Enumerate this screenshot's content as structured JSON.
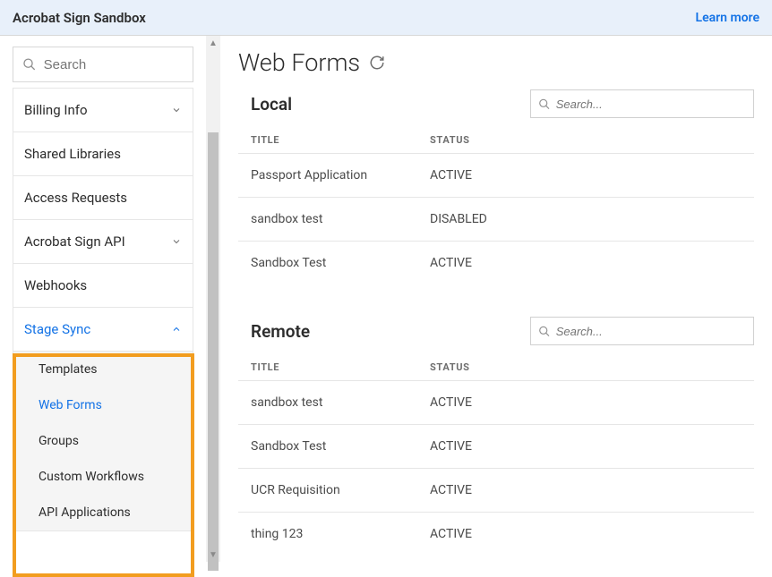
{
  "top": {
    "title": "Acrobat Sign Sandbox",
    "learn_more": "Learn more"
  },
  "sidebar": {
    "search_placeholder": "Search",
    "items": [
      {
        "label": "Billing Info",
        "chevron": "down"
      },
      {
        "label": "Shared Libraries"
      },
      {
        "label": "Access Requests"
      },
      {
        "label": "Acrobat Sign API",
        "chevron": "down"
      },
      {
        "label": "Webhooks"
      },
      {
        "label": "Stage Sync",
        "chevron": "up",
        "active": true
      }
    ],
    "stage_sync_children": [
      {
        "label": "Templates"
      },
      {
        "label": "Web Forms",
        "active": true
      },
      {
        "label": "Groups"
      },
      {
        "label": "Custom Workflows"
      },
      {
        "label": "API Applications"
      }
    ]
  },
  "main": {
    "title": "Web Forms",
    "columns": {
      "title": "TITLE",
      "status": "STATUS"
    },
    "search_placeholder": "Search...",
    "local": {
      "heading": "Local",
      "rows": [
        {
          "title": "Passport Application",
          "status": "ACTIVE"
        },
        {
          "title": "sandbox test",
          "status": "DISABLED"
        },
        {
          "title": "Sandbox Test",
          "status": "ACTIVE"
        }
      ]
    },
    "remote": {
      "heading": "Remote",
      "rows": [
        {
          "title": "sandbox test",
          "status": "ACTIVE"
        },
        {
          "title": "Sandbox Test",
          "status": "ACTIVE"
        },
        {
          "title": "UCR Requisition",
          "status": "ACTIVE"
        },
        {
          "title": "thing 123",
          "status": "ACTIVE"
        }
      ]
    }
  }
}
